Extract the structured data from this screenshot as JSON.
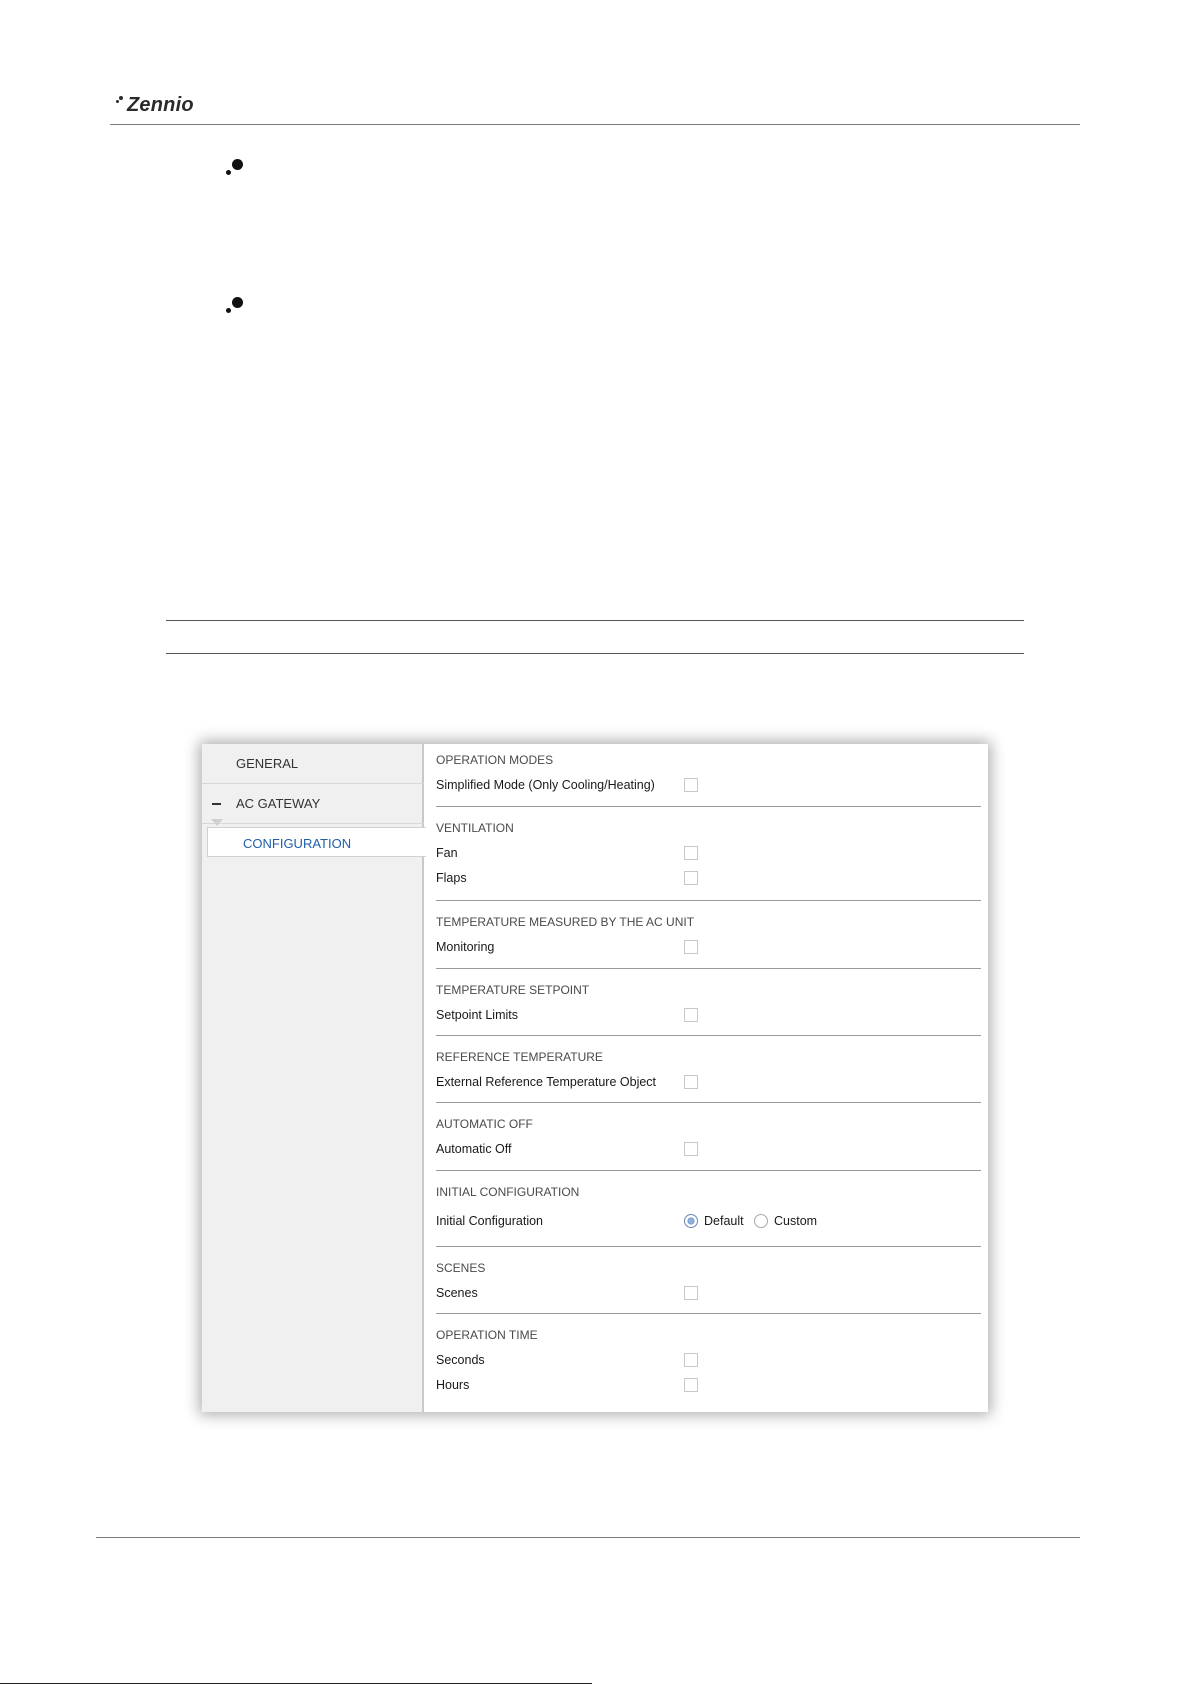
{
  "header": {
    "logo_text": "Zennio"
  },
  "sidebar": {
    "items": [
      {
        "label": "GENERAL"
      },
      {
        "label": "AC GATEWAY",
        "expander": "−"
      },
      {
        "label": "CONFIGURATION",
        "selected": true
      }
    ]
  },
  "sections": {
    "operation_modes": {
      "title": "OPERATION MODES",
      "rows": [
        {
          "label": "Simplified Mode (Only Cooling/Heating)",
          "checked": false
        }
      ]
    },
    "ventilation": {
      "title": "VENTILATION",
      "rows": [
        {
          "label": "Fan",
          "checked": false
        },
        {
          "label": "Flaps",
          "checked": false
        }
      ]
    },
    "temperature_measured": {
      "title": "TEMPERATURE MEASURED BY THE AC UNIT",
      "rows": [
        {
          "label": "Monitoring",
          "checked": false
        }
      ]
    },
    "temperature_setpoint": {
      "title": "TEMPERATURE SETPOINT",
      "rows": [
        {
          "label": "Setpoint Limits",
          "checked": false
        }
      ]
    },
    "reference_temperature": {
      "title": "REFERENCE TEMPERATURE",
      "rows": [
        {
          "label": "External Reference Temperature Object",
          "checked": false
        }
      ]
    },
    "automatic_off": {
      "title": "AUTOMATIC OFF",
      "rows": [
        {
          "label": "Automatic Off",
          "checked": false
        }
      ]
    },
    "initial_configuration": {
      "title": "INITIAL CONFIGURATION",
      "label": "Initial Configuration",
      "options": [
        {
          "label": "Default",
          "selected": true
        },
        {
          "label": "Custom",
          "selected": false
        }
      ]
    },
    "scenes": {
      "title": "SCENES",
      "rows": [
        {
          "label": "Scenes",
          "checked": false
        }
      ]
    },
    "operation_time": {
      "title": "OPERATION TIME",
      "rows": [
        {
          "label": "Seconds",
          "checked": false
        },
        {
          "label": "Hours",
          "checked": false
        }
      ]
    }
  },
  "colors": {
    "selected_item": "#1f5fa8",
    "sidebar_bg": "#f0f0f0",
    "radio_selected": "#8fb0dc"
  }
}
